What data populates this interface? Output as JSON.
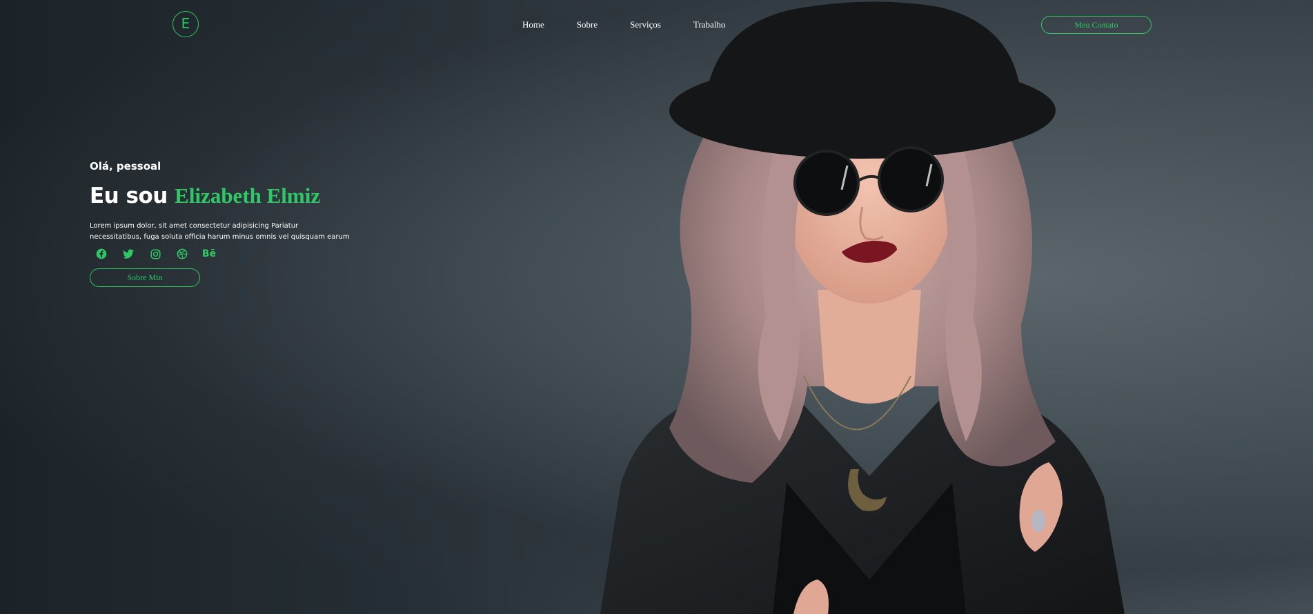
{
  "header": {
    "logo_letter": "E",
    "nav": [
      "Home",
      "Sobre",
      "Serviços",
      "Trabalho"
    ],
    "contact_label": "Meu Contato"
  },
  "intro": {
    "greeting": "Olá, pessoal",
    "headline_prefix": "Eu sou ",
    "headline_name": "Elizabeth Elmiz",
    "description_line1": "Lorem ipsum dolor, sit amet consectetur adipisicing Pariatur",
    "description_line2": "necessitatibus, fuga soluta officia harum minus omnis vel quisquam earum",
    "about_label": "Sobre Min"
  },
  "socials": {
    "icons": [
      "facebook-icon",
      "twitter-icon",
      "instagram-icon",
      "dribbble-icon",
      "behance-icon"
    ],
    "behance_text": "Bē"
  },
  "colors": {
    "accent": "#2ec866",
    "background": "#1d252b",
    "text": "#ffffff"
  }
}
